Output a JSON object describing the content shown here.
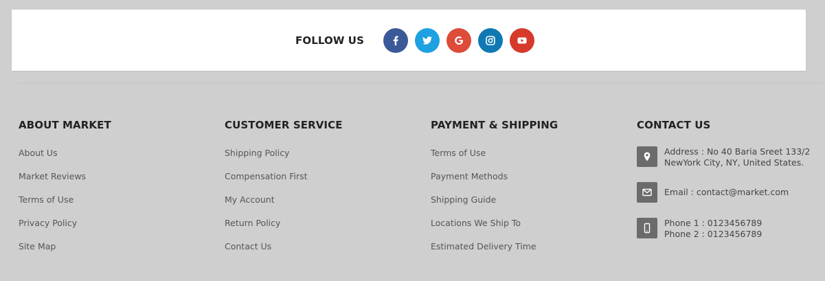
{
  "follow": {
    "title": "FOLLOW US",
    "social": [
      {
        "name": "facebook-icon",
        "color": "#3b5998"
      },
      {
        "name": "twitter-icon",
        "color": "#1da1e0"
      },
      {
        "name": "google-icon",
        "color": "#dd4b39"
      },
      {
        "name": "instagram-icon",
        "color": "#1079b3"
      },
      {
        "name": "youtube-icon",
        "color": "#d63a2b"
      }
    ]
  },
  "columns": {
    "about": {
      "title": "ABOUT MARKET",
      "links": [
        "About Us",
        "Market Reviews",
        "Terms of Use",
        "Privacy Policy",
        "Site Map"
      ]
    },
    "service": {
      "title": "CUSTOMER SERVICE",
      "links": [
        "Shipping Policy",
        "Compensation First",
        "My Account",
        "Return Policy",
        "Contact Us"
      ]
    },
    "payment": {
      "title": "PAYMENT & SHIPPING",
      "links": [
        "Terms of Use",
        "Payment Methods",
        "Shipping Guide",
        "Locations We Ship To",
        "Estimated Delivery Time"
      ]
    },
    "contact": {
      "title": "CONTACT US",
      "address_line1": "Address : No 40 Baria Sreet 133/2",
      "address_line2": "NewYork City, NY, United States.",
      "email": "Email : contact@market.com",
      "phone1": "Phone 1 : 0123456789",
      "phone2": "Phone 2 : 0123456789"
    }
  }
}
